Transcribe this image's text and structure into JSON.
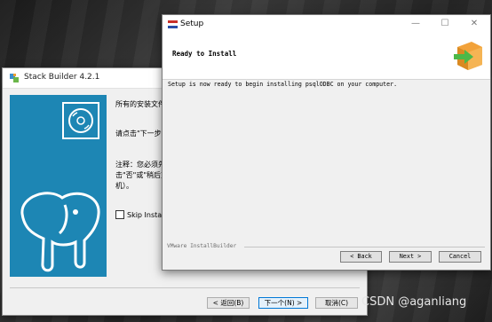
{
  "stack_builder": {
    "title": "Stack Builder 4.2.1",
    "line1": "所有的安装文件",
    "line2": "请点击\"下一步\"",
    "line3": "注释：您必须先",
    "line4": "击\"否\"或\"稍后重",
    "line5": "机）。",
    "skip_label": "Skip Install",
    "back_button": "< 返回(B)",
    "next_button": "下一个(N) >",
    "cancel_button": "取消(C)"
  },
  "setup": {
    "title": "Setup",
    "header_title": "Ready to Install",
    "body_text": "Setup is now ready to begin installing psqlODBC on your computer.",
    "footer_label": "VMware InstallBuilder",
    "back_button": "< Back",
    "next_button": "Next >",
    "cancel_button": "Cancel",
    "window_controls": {
      "minimize": "—",
      "maximize": "☐",
      "close": "✕"
    }
  },
  "watermark": "CSDN @aganliang",
  "colors": {
    "banner_blue": "#1d86b4",
    "box_orange": "#f2a23a",
    "arrow_green": "#4cb848"
  }
}
